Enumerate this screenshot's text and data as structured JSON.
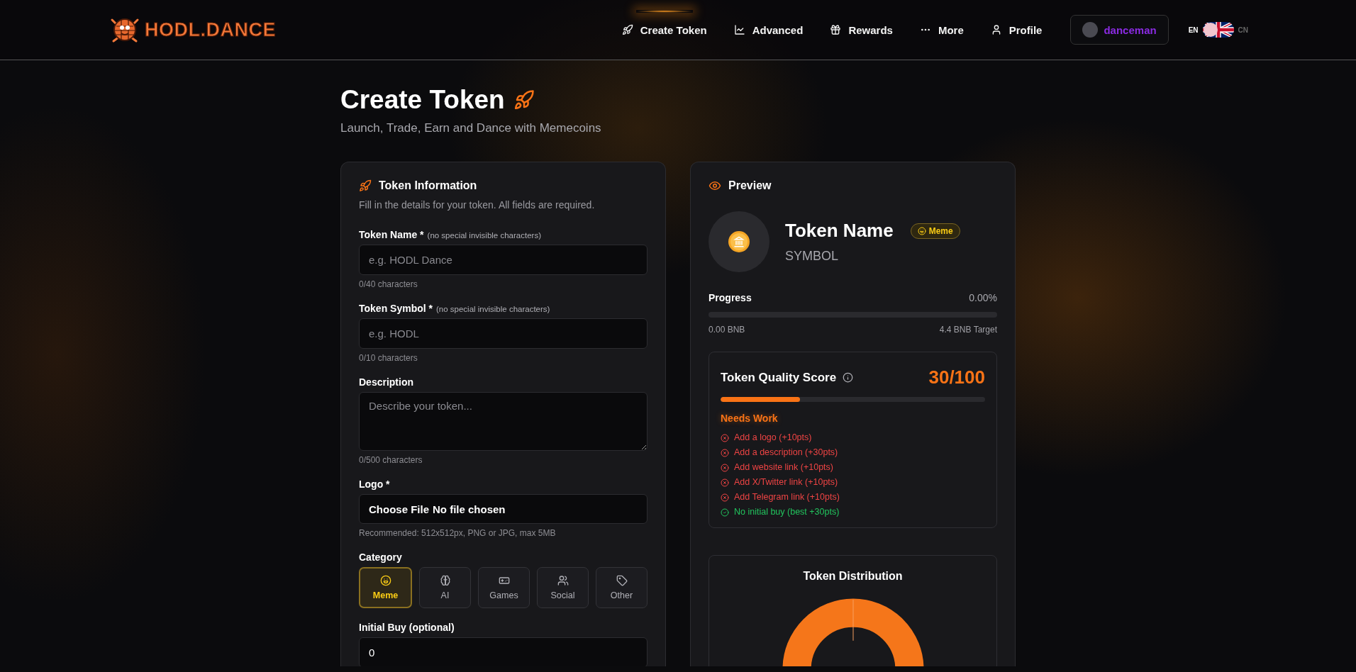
{
  "header": {
    "logo_text": "HODL.DANCE",
    "nav": [
      {
        "label": "Create Token",
        "selected": true
      },
      {
        "label": "Advanced",
        "selected": false
      },
      {
        "label": "Rewards",
        "selected": false
      },
      {
        "label": "More",
        "selected": false
      },
      {
        "label": "Profile",
        "selected": false
      }
    ],
    "user": {
      "name": "danceman"
    },
    "languages": [
      {
        "label": "EN",
        "selected": true
      },
      {
        "label": "CN",
        "selected": false
      }
    ]
  },
  "page": {
    "title": "Create Token",
    "subtitle": "Launch, Trade, Earn and Dance with Memecoins"
  },
  "form": {
    "title": "Token Information",
    "description": "Fill in the details for your token. All fields are required.",
    "fields": [
      {
        "kind": "input",
        "label": "Token Name *",
        "hint": "(no special invisible characters)",
        "placeholder": "e.g. HODL Dance",
        "counter": "0/40 characters"
      },
      {
        "kind": "input",
        "label": "Token Symbol *",
        "hint": "(no special invisible characters)",
        "placeholder": "e.g. HODL",
        "counter": "0/10 characters"
      },
      {
        "kind": "textarea",
        "label": "Description",
        "placeholder": "Describe your token...",
        "counter": "0/500 characters"
      },
      {
        "kind": "file",
        "label": "Logo *",
        "button": "Choose File",
        "value": "No file chosen",
        "counter": "Recommended: 512x512px, PNG or JPG, max 5MB"
      },
      {
        "kind": "category",
        "label": "Category",
        "options": [
          {
            "label": "Meme",
            "selected": true
          },
          {
            "label": "AI",
            "selected": false
          },
          {
            "label": "Games",
            "selected": false
          },
          {
            "label": "Social",
            "selected": false
          },
          {
            "label": "Other",
            "selected": false
          }
        ]
      },
      {
        "kind": "input",
        "label": "Initial Buy (optional)",
        "value": "0"
      }
    ]
  },
  "preview": {
    "title": "Preview",
    "token_name": "Token Name",
    "symbol": "SYMBOL",
    "category": "Meme",
    "progress": {
      "label": "Progress",
      "percent": "0.00%",
      "level": 0,
      "raised": "0.00 BNB",
      "target": "4.4 BNB Target"
    },
    "quality": {
      "title": "Token Quality Score",
      "score": "30/100",
      "level": 0.3,
      "status": "Needs Work",
      "items": [
        {
          "text": "Add a logo (+10pts)",
          "done": false
        },
        {
          "text": "Add a description (+30pts)",
          "done": false
        },
        {
          "text": "Add website link (+10pts)",
          "done": false
        },
        {
          "text": "Add X/Twitter link (+10pts)",
          "done": false
        },
        {
          "text": "Add Telegram link (+10pts)",
          "done": false
        },
        {
          "text": "No initial buy (best +30pts)",
          "done": true
        }
      ]
    },
    "distribution": {
      "title": "Token Distribution"
    }
  }
}
